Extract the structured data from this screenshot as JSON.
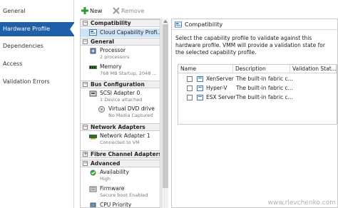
{
  "nav": {
    "items": [
      {
        "label": "General"
      },
      {
        "label": "Hardware Profile"
      },
      {
        "label": "Dependencies"
      },
      {
        "label": "Access"
      },
      {
        "label": "Validation Errors"
      }
    ],
    "active_index": 1
  },
  "toolbar": {
    "new_label": "New",
    "remove_label": "Remove"
  },
  "tree": {
    "sections": {
      "compatibility": "Compatibility",
      "general": "General",
      "bus": "Bus Configuration",
      "network": "Network Adapters",
      "fibre": "Fibre Channel Adapters",
      "advanced": "Advanced"
    },
    "items": {
      "capability": {
        "title": "Cloud Capability Profi..."
      },
      "processor": {
        "title": "Processor",
        "sub": "2 processors"
      },
      "memory": {
        "title": "Memory",
        "sub": "768 MB Startup, 2048 ..."
      },
      "scsi": {
        "title": "SCSI Adapter 0",
        "sub": "1 Device attached"
      },
      "dvd": {
        "title": "Virtual DVD drive",
        "sub": "No Media Captured"
      },
      "netadapter": {
        "title": "Network Adapter 1",
        "sub": "Connected to VM"
      },
      "availability": {
        "title": "Availability",
        "sub": "High"
      },
      "firmware": {
        "title": "Firmware",
        "sub": "Secure boot Enabled"
      },
      "cpu": {
        "title": "CPU Priority"
      }
    }
  },
  "detail": {
    "title": "Compatibility",
    "description": "Select the capability profile to validate against this hardware profile. VMM will provide a validation state for the selected capability profile.",
    "columns": [
      "Name",
      "Description",
      "Validation Stat..."
    ],
    "rows": [
      {
        "name": "XenServer",
        "description": "The built-in fabric c..."
      },
      {
        "name": "Hyper-V",
        "description": "The built-in fabric c..."
      },
      {
        "name": "ESX Server",
        "description": "The built-in fabric c..."
      }
    ]
  },
  "watermark": "www.rlevchenko.com",
  "colors": {
    "accent": "#1d5fa8",
    "selection": "#cde3f7",
    "section_bg": "#efefef"
  }
}
